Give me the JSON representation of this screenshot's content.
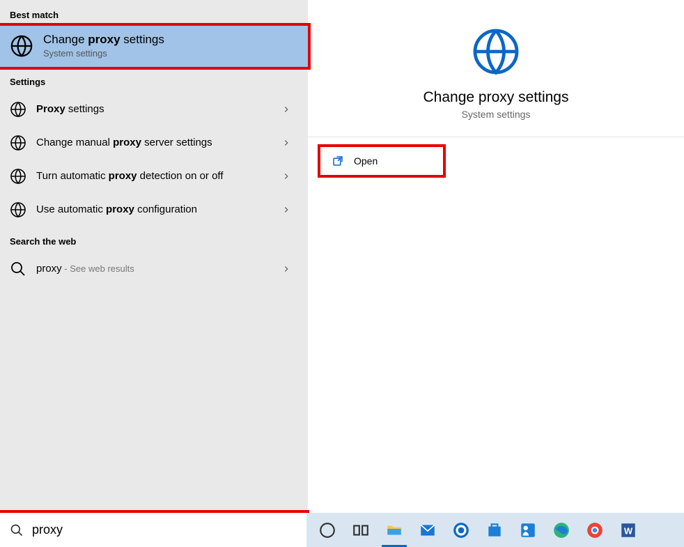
{
  "left": {
    "section_best": "Best match",
    "best_match": {
      "title_pre": "Change ",
      "title_bold": "proxy",
      "title_post": " settings",
      "subtitle": "System settings"
    },
    "section_settings": "Settings",
    "settings_items": [
      {
        "pre": "",
        "bold": "Proxy",
        "post": " settings"
      },
      {
        "pre": "Change manual ",
        "bold": "proxy",
        "post": " server settings"
      },
      {
        "pre": "Turn automatic ",
        "bold": "proxy",
        "post": " detection on or off"
      },
      {
        "pre": "Use automatic ",
        "bold": "proxy",
        "post": " configuration"
      }
    ],
    "section_web": "Search the web",
    "web_item": {
      "term": "proxy",
      "suffix": " - See web results"
    }
  },
  "right": {
    "title": "Change proxy settings",
    "subtitle": "System settings",
    "action_open": "Open"
  },
  "search": {
    "value": "proxy"
  },
  "taskbar": {
    "items": [
      "cortana-icon",
      "task-view-icon",
      "file-explorer-icon",
      "mail-icon",
      "dell-icon",
      "store-icon",
      "support-icon",
      "edge-icon",
      "chrome-icon",
      "word-icon"
    ]
  }
}
